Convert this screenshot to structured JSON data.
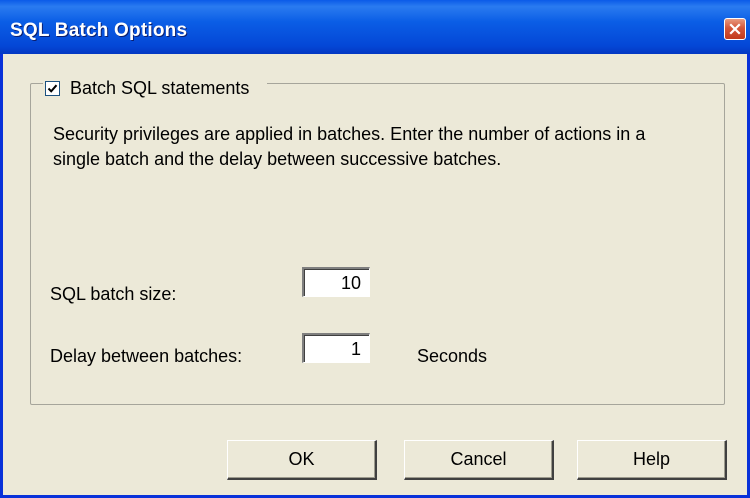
{
  "window": {
    "title": "SQL Batch Options"
  },
  "group": {
    "checkbox_label": "Batch SQL statements",
    "checked": true,
    "description": "Security privileges are applied in batches. Enter the number of actions in a single batch and the delay between successive batches."
  },
  "fields": {
    "batch_size_label": "SQL batch size:",
    "batch_size_value": "10",
    "delay_label": "Delay between batches:",
    "delay_value": "1",
    "delay_unit": "Seconds"
  },
  "buttons": {
    "ok": "OK",
    "cancel": "Cancel",
    "help": "Help"
  },
  "colors": {
    "titlebar": "#0447d6",
    "close_button": "#c23a1c",
    "dialog_bg": "#ece9d8"
  }
}
